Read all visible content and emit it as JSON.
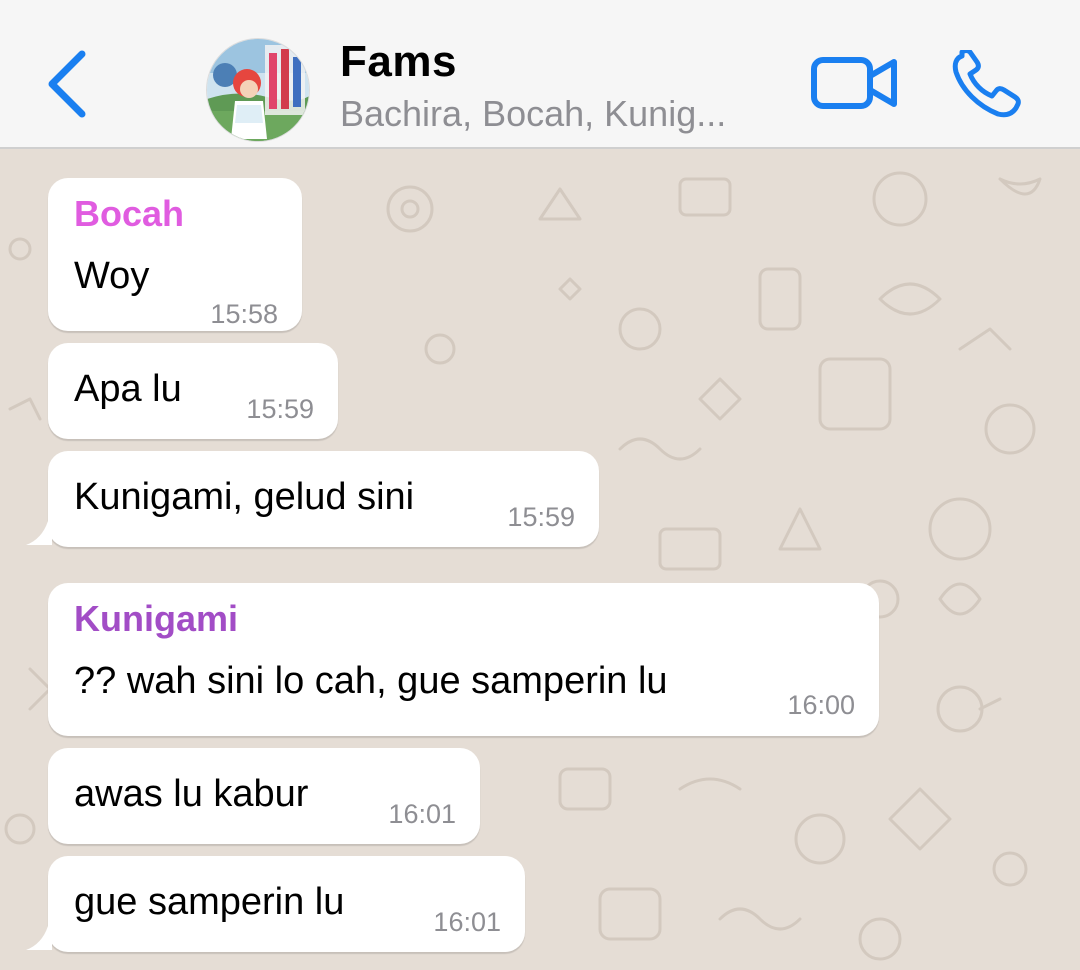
{
  "header": {
    "back_icon": "chevron-left-icon",
    "title": "Fams",
    "subtitle": "Bachira, Bocah, Kunig...",
    "avatar_icon": "group-avatar",
    "video_icon": "video-camera-icon",
    "call_icon": "phone-icon",
    "accent_color": "#1a7ff0"
  },
  "wallpaper": {
    "background_color": "#e5ddd5"
  },
  "messages": [
    {
      "sender": "Bocah",
      "sender_color": "#e05ce0",
      "text": "Woy",
      "time": "15:58"
    },
    {
      "text": "Apa lu",
      "time": "15:59"
    },
    {
      "text": "Kunigami, gelud sini",
      "time": "15:59"
    },
    {
      "sender": "Kunigami",
      "sender_color": "#a24dc6",
      "text": "?? wah sini lo cah, gue samperin lu",
      "time": "16:00"
    },
    {
      "text": "awas lu kabur",
      "time": "16:01"
    },
    {
      "text": "gue samperin lu",
      "time": "16:01"
    }
  ]
}
